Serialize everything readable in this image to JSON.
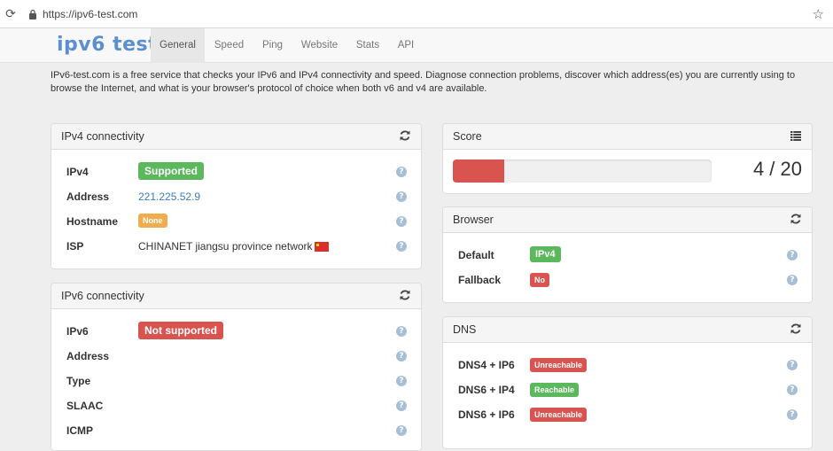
{
  "browser": {
    "url": "https://ipv6-test.com"
  },
  "nav": {
    "logo_a": "ipv6",
    "logo_b": " test",
    "tabs": [
      "General",
      "Speed",
      "Ping",
      "Website",
      "Stats",
      "API"
    ],
    "active": "General"
  },
  "intro": "IPv6-test.com is a free service that checks your IPv6 and IPv4 connectivity and speed. Diagnose connection problems, discover which address(es) you are currently using to browse the Internet, and what is your browser's protocol of choice when both v6 and v4 are available.",
  "ipv4": {
    "title": "IPv4 connectivity",
    "rows": [
      {
        "key": "IPv4",
        "value": "Supported",
        "status": "ok"
      },
      {
        "key": "Address",
        "value": "221.225.52.9"
      },
      {
        "key": "Hostname",
        "value": "None",
        "status": "warn"
      },
      {
        "key": "ISP",
        "value": "CHINANET jiangsu province network"
      }
    ]
  },
  "ipv6": {
    "title": "IPv6 connectivity",
    "rows": [
      {
        "key": "IPv6",
        "value": "Not supported",
        "status": "bad"
      },
      {
        "key": "Address",
        "value": ""
      },
      {
        "key": "Type",
        "value": ""
      },
      {
        "key": "SLAAC",
        "value": ""
      },
      {
        "key": "ICMP",
        "value": ""
      }
    ]
  },
  "score": {
    "title": "Score",
    "text": "4 / 20",
    "fraction": 0.2
  },
  "browserpanel": {
    "title": "Browser",
    "rows": [
      {
        "key": "Default",
        "value": "IPv4",
        "status": "ok"
      },
      {
        "key": "Fallback",
        "value": "No",
        "status": "bad"
      }
    ]
  },
  "dns": {
    "title": "DNS",
    "rows": [
      {
        "key": "DNS4 + IP6",
        "value": "Unreachable",
        "status": "bad"
      },
      {
        "key": "DNS6 + IP4",
        "value": "Reachable",
        "status": "ok"
      },
      {
        "key": "DNS6 + IP6",
        "value": "Unreachable",
        "status": "bad"
      }
    ]
  },
  "help_glyph": "?",
  "colors": {
    "ok": "#5cb85c",
    "warn": "#f0ad4e",
    "bad": "#d9534f",
    "link": "#3a7dbf"
  }
}
